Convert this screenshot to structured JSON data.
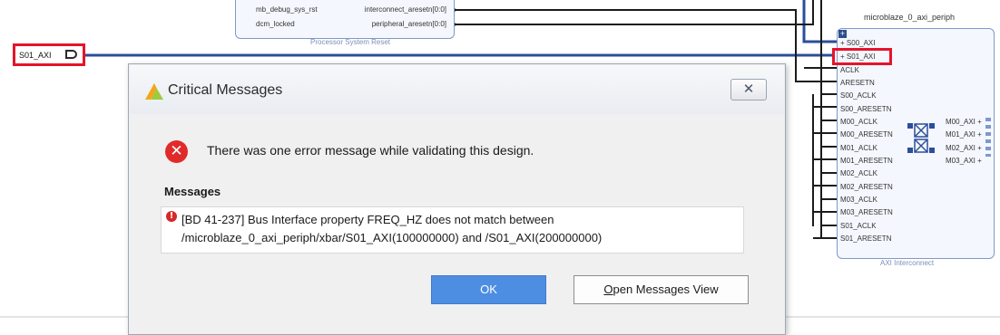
{
  "diagram": {
    "psr_block": {
      "caption": "Processor System Reset",
      "pins_left": [
        "mb_debug_sys_rst",
        "dcm_locked"
      ],
      "pins_right": [
        "interconnect_aresetn[0:0]",
        "peripheral_aresetn[0:0]"
      ]
    },
    "external_port": {
      "label": "S01_AXI"
    },
    "interconnect": {
      "title": "microblaze_0_axi_periph",
      "caption": "AXI Interconnect",
      "left_ports": [
        "S00_AXI",
        "S01_AXI",
        "ACLK",
        "ARESETN",
        "S00_ACLK",
        "S00_ARESETN",
        "M00_ACLK",
        "M00_ARESETN",
        "M01_ACLK",
        "M01_ARESETN",
        "M02_ACLK",
        "M02_ARESETN",
        "M03_ACLK",
        "M03_ARESETN",
        "S01_ACLK",
        "S01_ARESETN"
      ],
      "right_ports": [
        "M00_AXI",
        "M01_AXI",
        "M02_AXI",
        "M03_AXI"
      ]
    },
    "colors": {
      "wire": "#2b4e9a",
      "net": "#1b1b1b",
      "highlight": "#e4142b"
    }
  },
  "dialog": {
    "title": "Critical Messages",
    "close_glyph": "✕",
    "headline": "There was one error message while validating this design.",
    "section_label": "Messages",
    "message": {
      "line1": "[BD 41-237] Bus Interface property FREQ_HZ does not match between",
      "line2": "/microblaze_0_axi_periph/xbar/S01_AXI(100000000) and /S01_AXI(200000000)"
    },
    "buttons": {
      "ok": "OK",
      "open_messages_mnemonic": "O",
      "open_messages_rest": "pen Messages View"
    },
    "colors": {
      "ok_bg": "#4d8ee3",
      "error": "#e02b2b"
    }
  }
}
